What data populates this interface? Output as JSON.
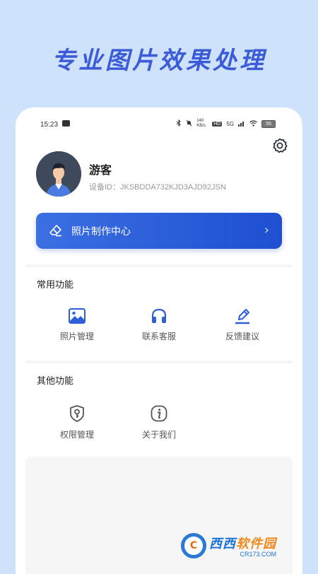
{
  "promo_title": "专业图片效果处理",
  "status_bar": {
    "time": "15:23",
    "network_speed": "140 KB/s",
    "signal": "5G",
    "battery": "55",
    "hd": "HD"
  },
  "profile": {
    "username": "游客",
    "device_id": "设备ID：JKSBDDA732KJD3AJD92JSN"
  },
  "banner": {
    "label": "照片制作中心",
    "chevron": "›"
  },
  "common_section": {
    "title": "常用功能",
    "items": [
      {
        "label": "照片管理",
        "icon": "image-icon"
      },
      {
        "label": "联系客服",
        "icon": "headphones-icon"
      },
      {
        "label": "反馈建议",
        "icon": "pencil-icon"
      }
    ]
  },
  "other_section": {
    "title": "其他功能",
    "items": [
      {
        "label": "权限管理",
        "icon": "shield-key-icon"
      },
      {
        "label": "关于我们",
        "icon": "info-icon"
      }
    ]
  },
  "watermark": {
    "logo_letter": "C",
    "brand_blue": "西西",
    "brand_orange": "软件园",
    "domain": "CR173.COM"
  },
  "colors": {
    "accent": "#2f5fd8",
    "background": "#cfe2fb",
    "promo_text": "#3b5bd9"
  }
}
